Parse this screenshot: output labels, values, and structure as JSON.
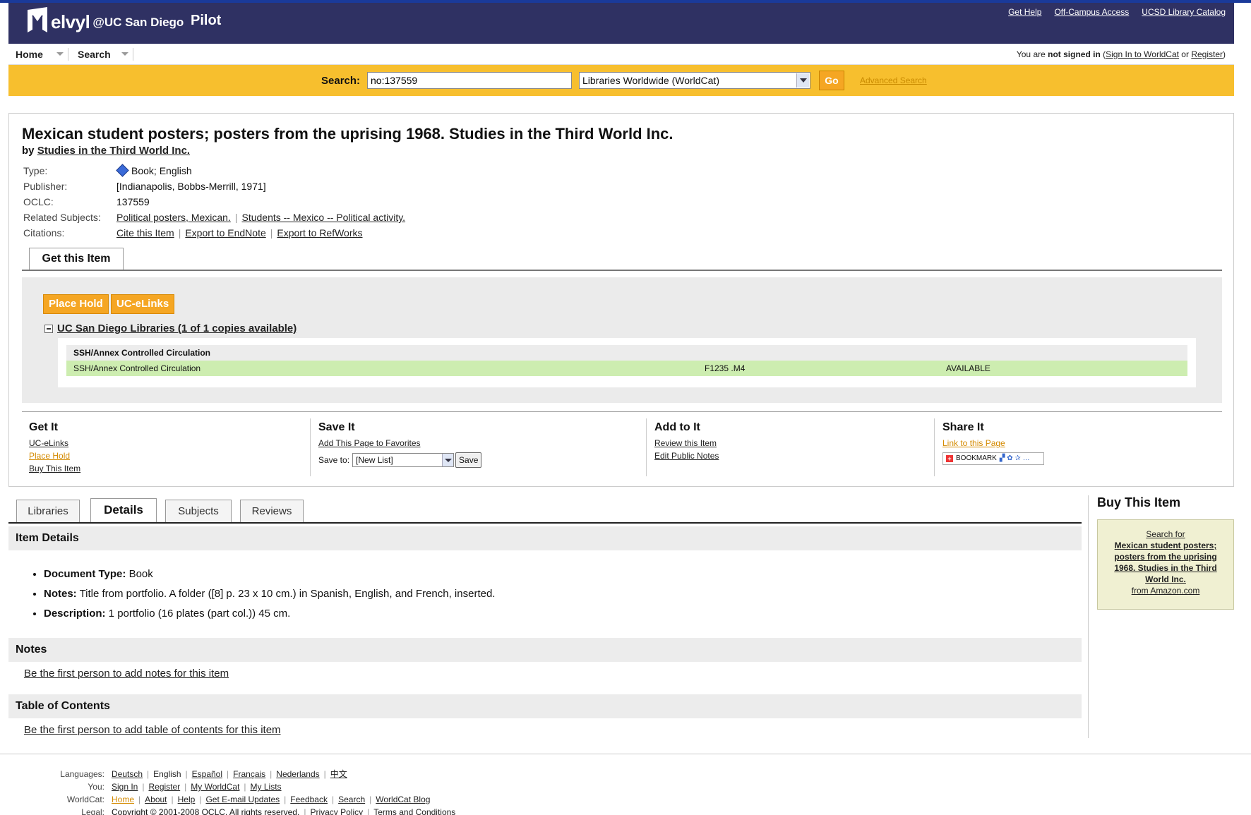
{
  "header": {
    "logo_text": "elvyl",
    "logo_at": "@UC San Diego",
    "pilot": "Pilot",
    "links": [
      "Get Help",
      "Off-Campus Access",
      "UCSD Library Catalog"
    ]
  },
  "nav": {
    "home": "Home",
    "search": "Search",
    "signin_prefix": "You are ",
    "signin_bold": "not signed in",
    "signin_open": " (",
    "signin_link": "Sign In to WorldCat",
    "signin_or": " or ",
    "register_link": "Register",
    "signin_close": ")"
  },
  "search": {
    "label": "Search:",
    "value": "no:137559",
    "scope": "Libraries Worldwide (WorldCat)",
    "go": "Go",
    "advanced": "Advanced Search"
  },
  "record": {
    "title": "Mexican student posters; posters from the uprising 1968. Studies in the Third World Inc.",
    "by_label": "by",
    "author": "Studies in the Third World Inc.",
    "type_label": "Type:",
    "type_value": "Book; English",
    "publisher_label": "Publisher:",
    "publisher_value": "[Indianapolis, Bobbs-Merrill, 1971]",
    "oclc_label": "OCLC:",
    "oclc_value": "137559",
    "subjects_label": "Related Subjects:",
    "subjects": [
      "Political posters, Mexican.",
      "Students -- Mexico -- Political activity."
    ],
    "citations_label": "Citations:",
    "citations": [
      "Cite this Item",
      "Export to EndNote",
      "Export to RefWorks"
    ]
  },
  "get_item": {
    "tab": "Get this Item",
    "place_hold": "Place Hold",
    "uc_elinks": "UC-eLinks",
    "library_heading": "UC San Diego Libraries (1 of 1 copies available)",
    "table_head": "SSH/Annex Controlled Circulation",
    "row": {
      "location": "SSH/Annex Controlled Circulation",
      "callno": "F1235 .M4",
      "status": "AVAILABLE"
    }
  },
  "actions": {
    "get_it": {
      "title": "Get It",
      "links": [
        "UC-eLinks",
        "Place Hold",
        "Buy This Item"
      ]
    },
    "save_it": {
      "title": "Save It",
      "link": "Add This Page to Favorites",
      "save_to": "Save to:",
      "list": "[New List]",
      "save_btn": "Save"
    },
    "add_to_it": {
      "title": "Add to It",
      "links": [
        "Review this Item",
        "Edit Public Notes"
      ]
    },
    "share_it": {
      "title": "Share It",
      "link": "Link to this Page",
      "bookmark": "BOOKMARK"
    }
  },
  "tabs": [
    "Libraries",
    "Details",
    "Subjects",
    "Reviews"
  ],
  "details": {
    "heading": "Item Details",
    "items": [
      {
        "k": "Document Type:",
        "v": " Book"
      },
      {
        "k": "Notes:",
        "v": " Title from portfolio. A folder ([8] p. 23 x 10 cm.) in Spanish, English, and French, inserted."
      },
      {
        "k": "Description:",
        "v": " 1 portfolio (16 plates (part col.)) 45 cm."
      }
    ]
  },
  "notes": {
    "heading": "Notes",
    "link": "Be the first person to add notes for this item"
  },
  "toc": {
    "heading": "Table of Contents",
    "link": "Be the first person to add table of contents for this item"
  },
  "sidebar": {
    "title": "Buy This Item",
    "search_for": "Search for",
    "book_title": "Mexican student posters; posters from the uprising 1968. Studies in the Third World Inc.",
    "from": "from Amazon.com"
  },
  "footer": {
    "languages_label": "Languages:",
    "languages": [
      "Deutsch",
      "English",
      "Español",
      "Français",
      "Nederlands",
      "中文"
    ],
    "you_label": "You:",
    "you": [
      "Sign In",
      "Register",
      "My WorldCat",
      "My Lists"
    ],
    "worldcat_label": "WorldCat:",
    "worldcat": [
      "Home",
      "About",
      "Help",
      "Get E-mail Updates",
      "Feedback",
      "Search",
      "WorldCat Blog"
    ],
    "legal_label": "Legal:",
    "legal": [
      "Copyright © 2001-2008 OCLC. All rights reserved.",
      "Privacy Policy",
      "Terms and Conditions"
    ]
  }
}
